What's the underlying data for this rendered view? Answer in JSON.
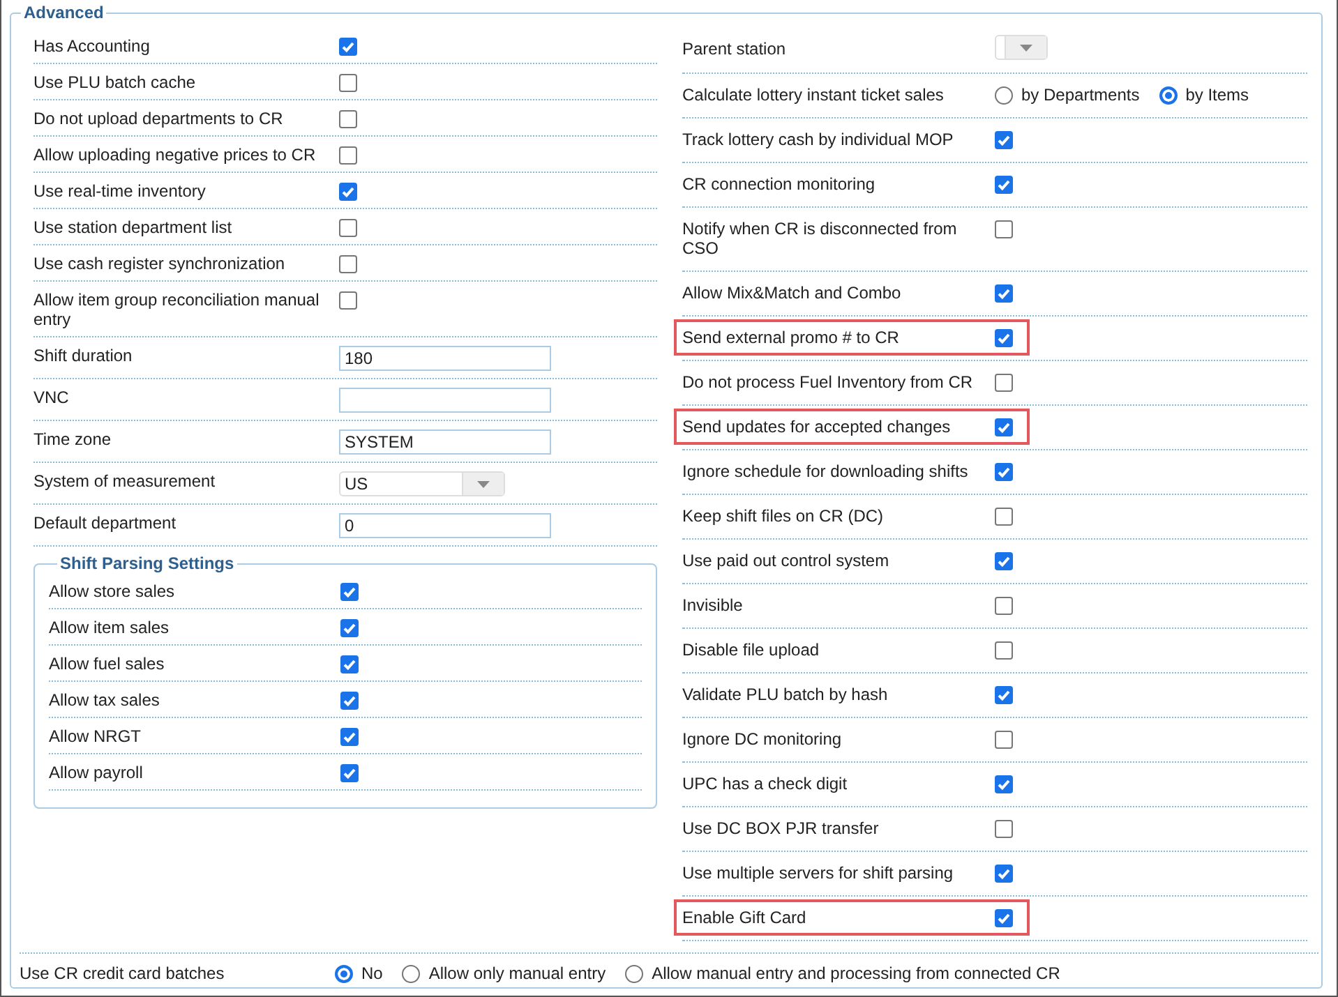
{
  "section": {
    "title": "Advanced"
  },
  "left": [
    {
      "kind": "checkbox",
      "label": "Has Accounting",
      "checked": true
    },
    {
      "kind": "checkbox",
      "label": "Use PLU batch cache",
      "checked": false
    },
    {
      "kind": "checkbox",
      "label": "Do not upload departments to CR",
      "checked": false
    },
    {
      "kind": "checkbox",
      "label": "Allow uploading negative prices to CR",
      "checked": false
    },
    {
      "kind": "checkbox",
      "label": "Use real-time inventory",
      "checked": true
    },
    {
      "kind": "checkbox",
      "label": "Use station department list",
      "checked": false
    },
    {
      "kind": "checkbox",
      "label": "Use cash register synchronization",
      "checked": false
    },
    {
      "kind": "checkbox",
      "label": "Allow item group reconciliation manual entry",
      "checked": false
    },
    {
      "kind": "text",
      "label": "Shift duration",
      "value": "180"
    },
    {
      "kind": "text",
      "label": "VNC"
    },
    {
      "kind": "text",
      "label": "Time zone",
      "value": "SYSTEM"
    },
    {
      "kind": "select",
      "label": "System of measurement",
      "value": "US"
    },
    {
      "kind": "text",
      "label": "Default department",
      "value": "0"
    }
  ],
  "shift_parsing": {
    "title": "Shift Parsing Settings",
    "items": [
      {
        "label": "Allow store sales",
        "checked": true
      },
      {
        "label": "Allow item sales",
        "checked": true
      },
      {
        "label": "Allow fuel sales",
        "checked": true
      },
      {
        "label": "Allow tax sales",
        "checked": true
      },
      {
        "label": "Allow NRGT",
        "checked": true
      },
      {
        "label": "Allow payroll",
        "checked": true
      }
    ]
  },
  "right": [
    {
      "kind": "select",
      "label": "Parent station"
    },
    {
      "kind": "radio",
      "label": "Calculate lottery instant ticket sales",
      "options": [
        {
          "label": "by Departments",
          "selected": false
        },
        {
          "label": "by Items",
          "selected": true
        }
      ]
    },
    {
      "kind": "checkbox",
      "label": "Track lottery cash by individual MOP",
      "checked": true,
      "highlighted": false
    },
    {
      "kind": "checkbox",
      "label": "CR connection monitoring",
      "checked": true,
      "highlighted": false
    },
    {
      "kind": "checkbox",
      "label": "Notify when CR is disconnected from CSO",
      "checked": false,
      "highlighted": false
    },
    {
      "kind": "checkbox",
      "label": "Allow Mix&Match and Combo",
      "checked": true,
      "highlighted": false
    },
    {
      "kind": "checkbox",
      "label": "Send external promo # to CR",
      "checked": true,
      "highlighted": true
    },
    {
      "kind": "checkbox",
      "label": "Do not process Fuel Inventory from CR",
      "checked": false,
      "highlighted": false
    },
    {
      "kind": "checkbox",
      "label": "Send updates for accepted changes",
      "checked": true,
      "highlighted": true
    },
    {
      "kind": "checkbox",
      "label": "Ignore schedule for downloading shifts",
      "checked": true,
      "highlighted": false
    },
    {
      "kind": "checkbox",
      "label": "Keep shift files on CR (DC)",
      "checked": false,
      "highlighted": false
    },
    {
      "kind": "checkbox",
      "label": "Use paid out control system",
      "checked": true,
      "highlighted": false
    },
    {
      "kind": "checkbox",
      "label": "Invisible",
      "checked": false,
      "highlighted": false
    },
    {
      "kind": "checkbox",
      "label": "Disable file upload",
      "checked": false,
      "highlighted": false
    },
    {
      "kind": "checkbox",
      "label": "Validate PLU batch by hash",
      "checked": true,
      "highlighted": false
    },
    {
      "kind": "checkbox",
      "label": "Ignore DC monitoring",
      "checked": false,
      "highlighted": false
    },
    {
      "kind": "checkbox",
      "label": "UPC has a check digit",
      "checked": true,
      "highlighted": false
    },
    {
      "kind": "checkbox",
      "label": "Use DC BOX PJR transfer",
      "checked": false,
      "highlighted": false
    },
    {
      "kind": "checkbox",
      "label": "Use multiple servers for shift parsing",
      "checked": true,
      "highlighted": false
    },
    {
      "kind": "checkbox",
      "label": "Enable Gift Card",
      "checked": true,
      "highlighted": true
    }
  ],
  "bottom": {
    "kind": "radio",
    "label": "Use CR credit card batches",
    "options": [
      {
        "label": "No",
        "selected": true
      },
      {
        "label": "Allow only manual entry",
        "selected": false
      },
      {
        "label": "Allow manual entry and processing from connected CR",
        "selected": false
      }
    ]
  }
}
